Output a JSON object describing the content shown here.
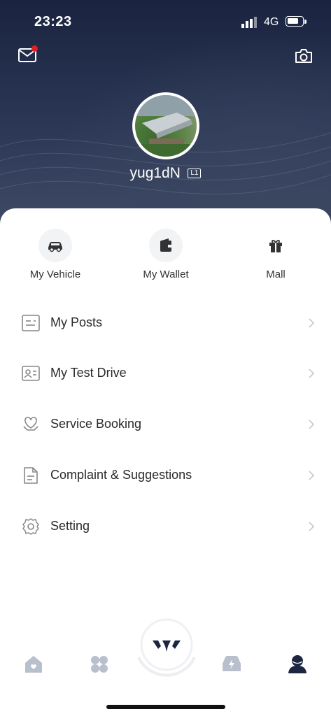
{
  "status_bar": {
    "time": "23:23",
    "network": "4G"
  },
  "profile": {
    "username": "yug1dN",
    "level": "L1"
  },
  "quick_actions": [
    {
      "label": "My Vehicle",
      "icon": "car-icon"
    },
    {
      "label": "My Wallet",
      "icon": "wallet-icon"
    },
    {
      "label": "Mall",
      "icon": "gift-icon"
    }
  ],
  "menu": [
    {
      "label": "My Posts",
      "icon": "posts-icon"
    },
    {
      "label": "My Test Drive",
      "icon": "id-card-icon"
    },
    {
      "label": "Service Booking",
      "icon": "service-icon"
    },
    {
      "label": "Complaint & Suggestions",
      "icon": "document-icon"
    },
    {
      "label": "Setting",
      "icon": "gear-icon"
    }
  ],
  "tab_bar": [
    {
      "name": "home",
      "icon": "home-icon",
      "active": false
    },
    {
      "name": "discover",
      "icon": "grid-icon",
      "active": false
    },
    {
      "name": "center",
      "icon": "wuling-logo-icon",
      "active": false
    },
    {
      "name": "vehicle",
      "icon": "car-bolt-icon",
      "active": false
    },
    {
      "name": "me",
      "icon": "person-icon",
      "active": true
    }
  ],
  "colors": {
    "header": "#1f2a48",
    "accent_dark": "#1c2541",
    "inactive_tab": "#b8bfcd",
    "notification": "#e02020"
  }
}
